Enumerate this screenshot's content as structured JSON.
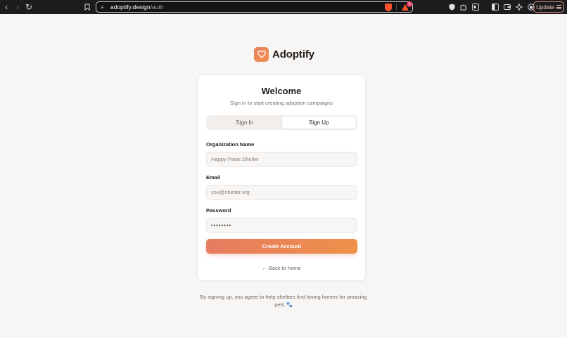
{
  "browser": {
    "url_host": "adoptify.design",
    "url_path": "/auth",
    "rewards_badge": "8",
    "update_label": "Update"
  },
  "brand": {
    "name": "Adoptify",
    "accent": "#ee8a58"
  },
  "auth": {
    "title": "Welcome",
    "subtitle": "Sign in to start creating adoption campaigns",
    "tabs": [
      {
        "label": "Sign In",
        "active": false
      },
      {
        "label": "Sign Up",
        "active": true
      }
    ],
    "org_label": "Organization Name",
    "org_placeholder": "Happy Paws Shelter",
    "email_label": "Email",
    "email_placeholder": "you@shelter.org",
    "password_label": "Password",
    "password_value": "••••••••",
    "submit_label": "Create Account",
    "back_label": "← Back to home"
  },
  "footer": {
    "text": "By signing up, you agree to help shelters find loving homes for amazing pets 🐾"
  }
}
